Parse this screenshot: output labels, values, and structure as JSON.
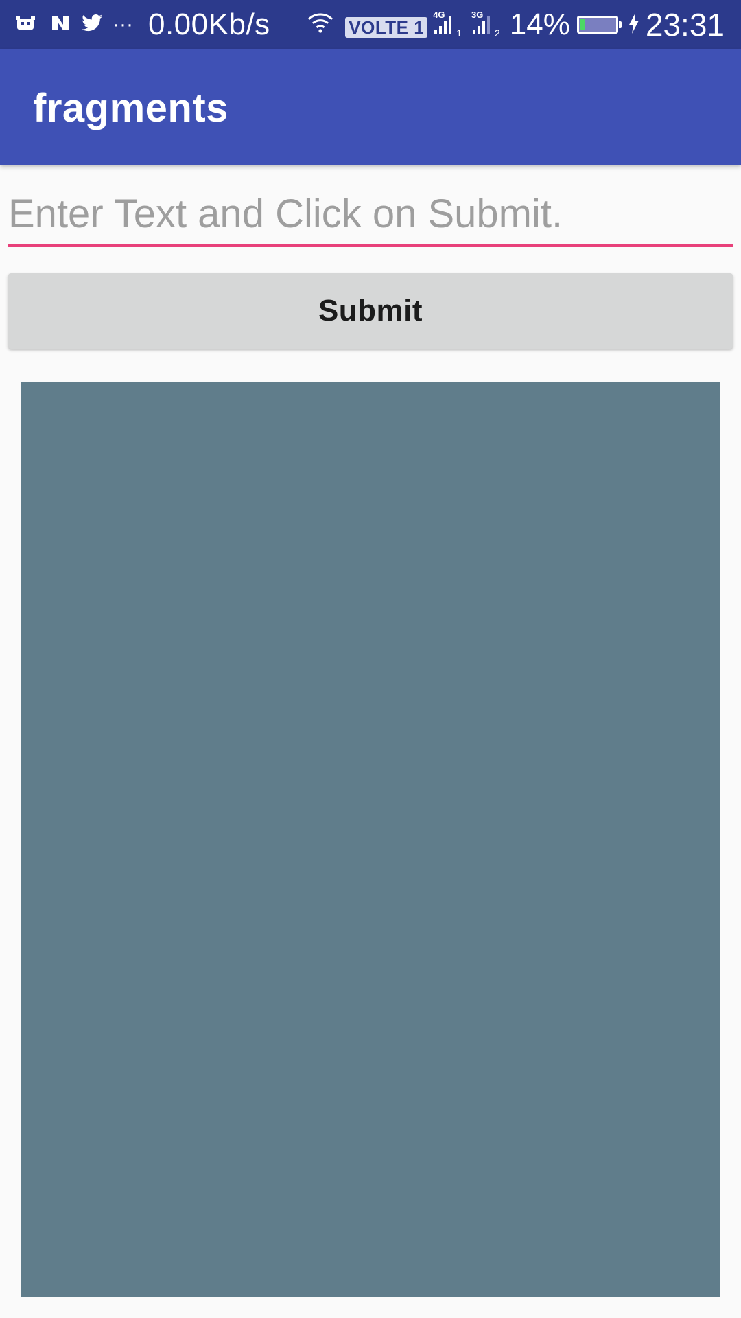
{
  "status_bar": {
    "network_speed": "0.00Kb/s",
    "more_indicator": "···",
    "volte_label": "VOLTE 1",
    "sim1_network": "4G",
    "sim1_index": "1",
    "sim2_network": "3G",
    "sim2_index": "2",
    "battery_percent": "14%",
    "battery_level": 0.14,
    "time": "23:31",
    "icons": [
      "bot-notification-icon",
      "n-logo-icon",
      "twitter-bird-icon",
      "wifi-icon",
      "signal-icon",
      "battery-icon",
      "charging-bolt-icon"
    ]
  },
  "app_bar": {
    "title": "fragments",
    "color": "#3f51b5"
  },
  "form": {
    "input_value": "",
    "input_placeholder": "Enter Text and Click on Submit.",
    "submit_label": "Submit",
    "accent_color": "#e8407a"
  },
  "fragment": {
    "color": "#607d8b"
  }
}
